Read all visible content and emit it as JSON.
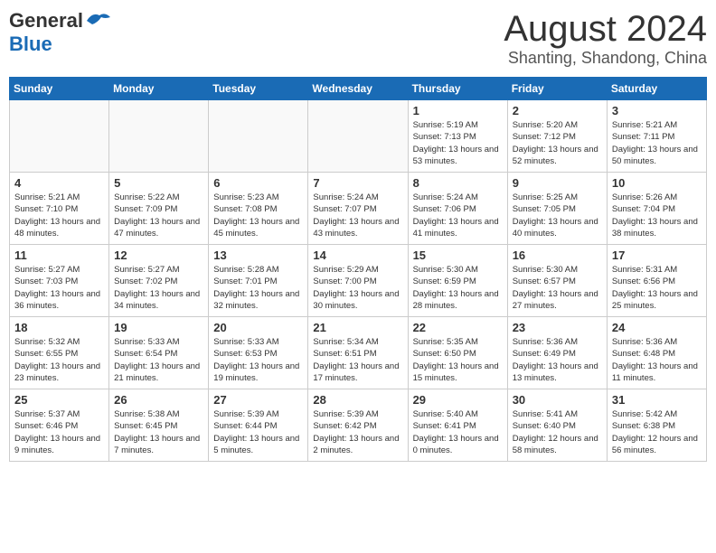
{
  "header": {
    "logo_general": "General",
    "logo_blue": "Blue",
    "title": "August 2024",
    "location": "Shanting, Shandong, China"
  },
  "weekdays": [
    "Sunday",
    "Monday",
    "Tuesday",
    "Wednesday",
    "Thursday",
    "Friday",
    "Saturday"
  ],
  "weeks": [
    [
      {
        "day": "",
        "info": ""
      },
      {
        "day": "",
        "info": ""
      },
      {
        "day": "",
        "info": ""
      },
      {
        "day": "",
        "info": ""
      },
      {
        "day": "1",
        "info": "Sunrise: 5:19 AM\nSunset: 7:13 PM\nDaylight: 13 hours\nand 53 minutes."
      },
      {
        "day": "2",
        "info": "Sunrise: 5:20 AM\nSunset: 7:12 PM\nDaylight: 13 hours\nand 52 minutes."
      },
      {
        "day": "3",
        "info": "Sunrise: 5:21 AM\nSunset: 7:11 PM\nDaylight: 13 hours\nand 50 minutes."
      }
    ],
    [
      {
        "day": "4",
        "info": "Sunrise: 5:21 AM\nSunset: 7:10 PM\nDaylight: 13 hours\nand 48 minutes."
      },
      {
        "day": "5",
        "info": "Sunrise: 5:22 AM\nSunset: 7:09 PM\nDaylight: 13 hours\nand 47 minutes."
      },
      {
        "day": "6",
        "info": "Sunrise: 5:23 AM\nSunset: 7:08 PM\nDaylight: 13 hours\nand 45 minutes."
      },
      {
        "day": "7",
        "info": "Sunrise: 5:24 AM\nSunset: 7:07 PM\nDaylight: 13 hours\nand 43 minutes."
      },
      {
        "day": "8",
        "info": "Sunrise: 5:24 AM\nSunset: 7:06 PM\nDaylight: 13 hours\nand 41 minutes."
      },
      {
        "day": "9",
        "info": "Sunrise: 5:25 AM\nSunset: 7:05 PM\nDaylight: 13 hours\nand 40 minutes."
      },
      {
        "day": "10",
        "info": "Sunrise: 5:26 AM\nSunset: 7:04 PM\nDaylight: 13 hours\nand 38 minutes."
      }
    ],
    [
      {
        "day": "11",
        "info": "Sunrise: 5:27 AM\nSunset: 7:03 PM\nDaylight: 13 hours\nand 36 minutes."
      },
      {
        "day": "12",
        "info": "Sunrise: 5:27 AM\nSunset: 7:02 PM\nDaylight: 13 hours\nand 34 minutes."
      },
      {
        "day": "13",
        "info": "Sunrise: 5:28 AM\nSunset: 7:01 PM\nDaylight: 13 hours\nand 32 minutes."
      },
      {
        "day": "14",
        "info": "Sunrise: 5:29 AM\nSunset: 7:00 PM\nDaylight: 13 hours\nand 30 minutes."
      },
      {
        "day": "15",
        "info": "Sunrise: 5:30 AM\nSunset: 6:59 PM\nDaylight: 13 hours\nand 28 minutes."
      },
      {
        "day": "16",
        "info": "Sunrise: 5:30 AM\nSunset: 6:57 PM\nDaylight: 13 hours\nand 27 minutes."
      },
      {
        "day": "17",
        "info": "Sunrise: 5:31 AM\nSunset: 6:56 PM\nDaylight: 13 hours\nand 25 minutes."
      }
    ],
    [
      {
        "day": "18",
        "info": "Sunrise: 5:32 AM\nSunset: 6:55 PM\nDaylight: 13 hours\nand 23 minutes."
      },
      {
        "day": "19",
        "info": "Sunrise: 5:33 AM\nSunset: 6:54 PM\nDaylight: 13 hours\nand 21 minutes."
      },
      {
        "day": "20",
        "info": "Sunrise: 5:33 AM\nSunset: 6:53 PM\nDaylight: 13 hours\nand 19 minutes."
      },
      {
        "day": "21",
        "info": "Sunrise: 5:34 AM\nSunset: 6:51 PM\nDaylight: 13 hours\nand 17 minutes."
      },
      {
        "day": "22",
        "info": "Sunrise: 5:35 AM\nSunset: 6:50 PM\nDaylight: 13 hours\nand 15 minutes."
      },
      {
        "day": "23",
        "info": "Sunrise: 5:36 AM\nSunset: 6:49 PM\nDaylight: 13 hours\nand 13 minutes."
      },
      {
        "day": "24",
        "info": "Sunrise: 5:36 AM\nSunset: 6:48 PM\nDaylight: 13 hours\nand 11 minutes."
      }
    ],
    [
      {
        "day": "25",
        "info": "Sunrise: 5:37 AM\nSunset: 6:46 PM\nDaylight: 13 hours\nand 9 minutes."
      },
      {
        "day": "26",
        "info": "Sunrise: 5:38 AM\nSunset: 6:45 PM\nDaylight: 13 hours\nand 7 minutes."
      },
      {
        "day": "27",
        "info": "Sunrise: 5:39 AM\nSunset: 6:44 PM\nDaylight: 13 hours\nand 5 minutes."
      },
      {
        "day": "28",
        "info": "Sunrise: 5:39 AM\nSunset: 6:42 PM\nDaylight: 13 hours\nand 2 minutes."
      },
      {
        "day": "29",
        "info": "Sunrise: 5:40 AM\nSunset: 6:41 PM\nDaylight: 13 hours\nand 0 minutes."
      },
      {
        "day": "30",
        "info": "Sunrise: 5:41 AM\nSunset: 6:40 PM\nDaylight: 12 hours\nand 58 minutes."
      },
      {
        "day": "31",
        "info": "Sunrise: 5:42 AM\nSunset: 6:38 PM\nDaylight: 12 hours\nand 56 minutes."
      }
    ]
  ]
}
